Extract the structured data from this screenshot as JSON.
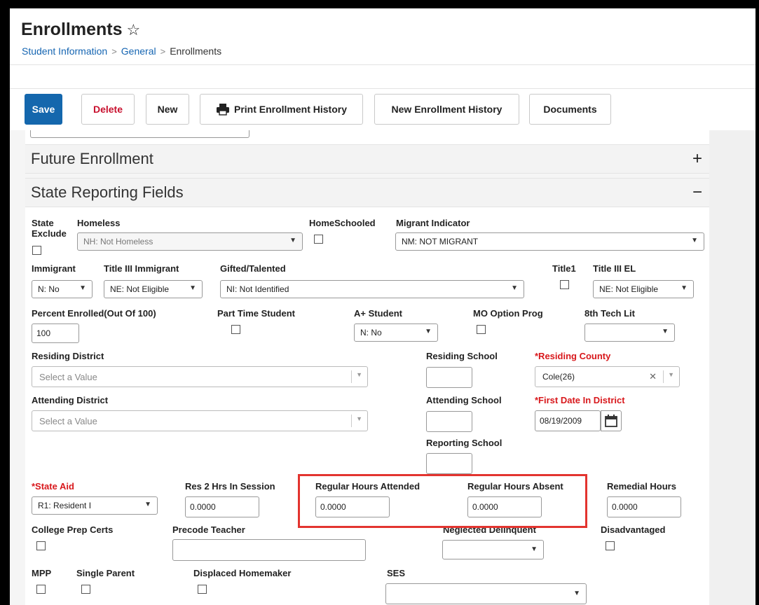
{
  "header": {
    "title": "Enrollments",
    "breadcrumb": [
      "Student Information",
      "General",
      "Enrollments"
    ]
  },
  "toolbar": {
    "save": "Save",
    "delete": "Delete",
    "new": "New",
    "print": "Print Enrollment History",
    "new_history": "New Enrollment History",
    "documents": "Documents"
  },
  "sections": {
    "future": "Future Enrollment",
    "state": "State Reporting Fields"
  },
  "fields": {
    "state_exclude": "State Exclude",
    "homeless": {
      "label": "Homeless",
      "value": "NH: Not Homeless"
    },
    "home_schooled": "HomeSchooled",
    "migrant": {
      "label": "Migrant Indicator",
      "value": "NM: NOT MIGRANT"
    },
    "immigrant": {
      "label": "Immigrant",
      "value": "N: No"
    },
    "title3_immigrant": {
      "label": "Title III Immigrant",
      "value": "NE: Not Eligible"
    },
    "gifted": {
      "label": "Gifted/Talented",
      "value": "NI: Not Identified"
    },
    "title1": "Title1",
    "title3_el": {
      "label": "Title III EL",
      "value": "NE: Not Eligible"
    },
    "percent_enrolled": {
      "label": "Percent Enrolled(Out Of 100)",
      "value": "100"
    },
    "part_time": "Part Time Student",
    "a_plus": {
      "label": "A+ Student",
      "value": "N: No"
    },
    "mo_option": "MO Option Prog",
    "tech_lit": {
      "label": "8th Tech Lit",
      "value": ""
    },
    "residing_district": {
      "label": "Residing District",
      "placeholder": "Select a Value"
    },
    "residing_school": "Residing School",
    "residing_county": {
      "label": "*Residing County",
      "value": "Cole(26)"
    },
    "attending_district": {
      "label": "Attending District",
      "placeholder": "Select a Value"
    },
    "attending_school": "Attending School",
    "first_date": {
      "label": "*First Date In District",
      "value": "08/19/2009"
    },
    "reporting_school": "Reporting School",
    "state_aid": {
      "label": "*State Aid",
      "value": "R1: Resident I"
    },
    "res2": {
      "label": "Res 2 Hrs In Session",
      "value": "0.0000"
    },
    "reg_attended": {
      "label": "Regular Hours Attended",
      "value": "0.0000"
    },
    "reg_absent": {
      "label": "Regular Hours Absent",
      "value": "0.0000"
    },
    "remedial": {
      "label": "Remedial Hours",
      "value": "0.0000"
    },
    "college_prep": "College Prep Certs",
    "precode": "Precode Teacher",
    "neglected": "Neglected Delinquent",
    "disadvantaged": "Disadvantaged",
    "mpp": "MPP",
    "single_parent": "Single Parent",
    "displaced": "Displaced Homemaker",
    "ses": "SES"
  },
  "colors": {
    "primary": "#1467ad",
    "danger": "#c8102e",
    "required": "#d8181c",
    "highlight": "#e3342f"
  }
}
